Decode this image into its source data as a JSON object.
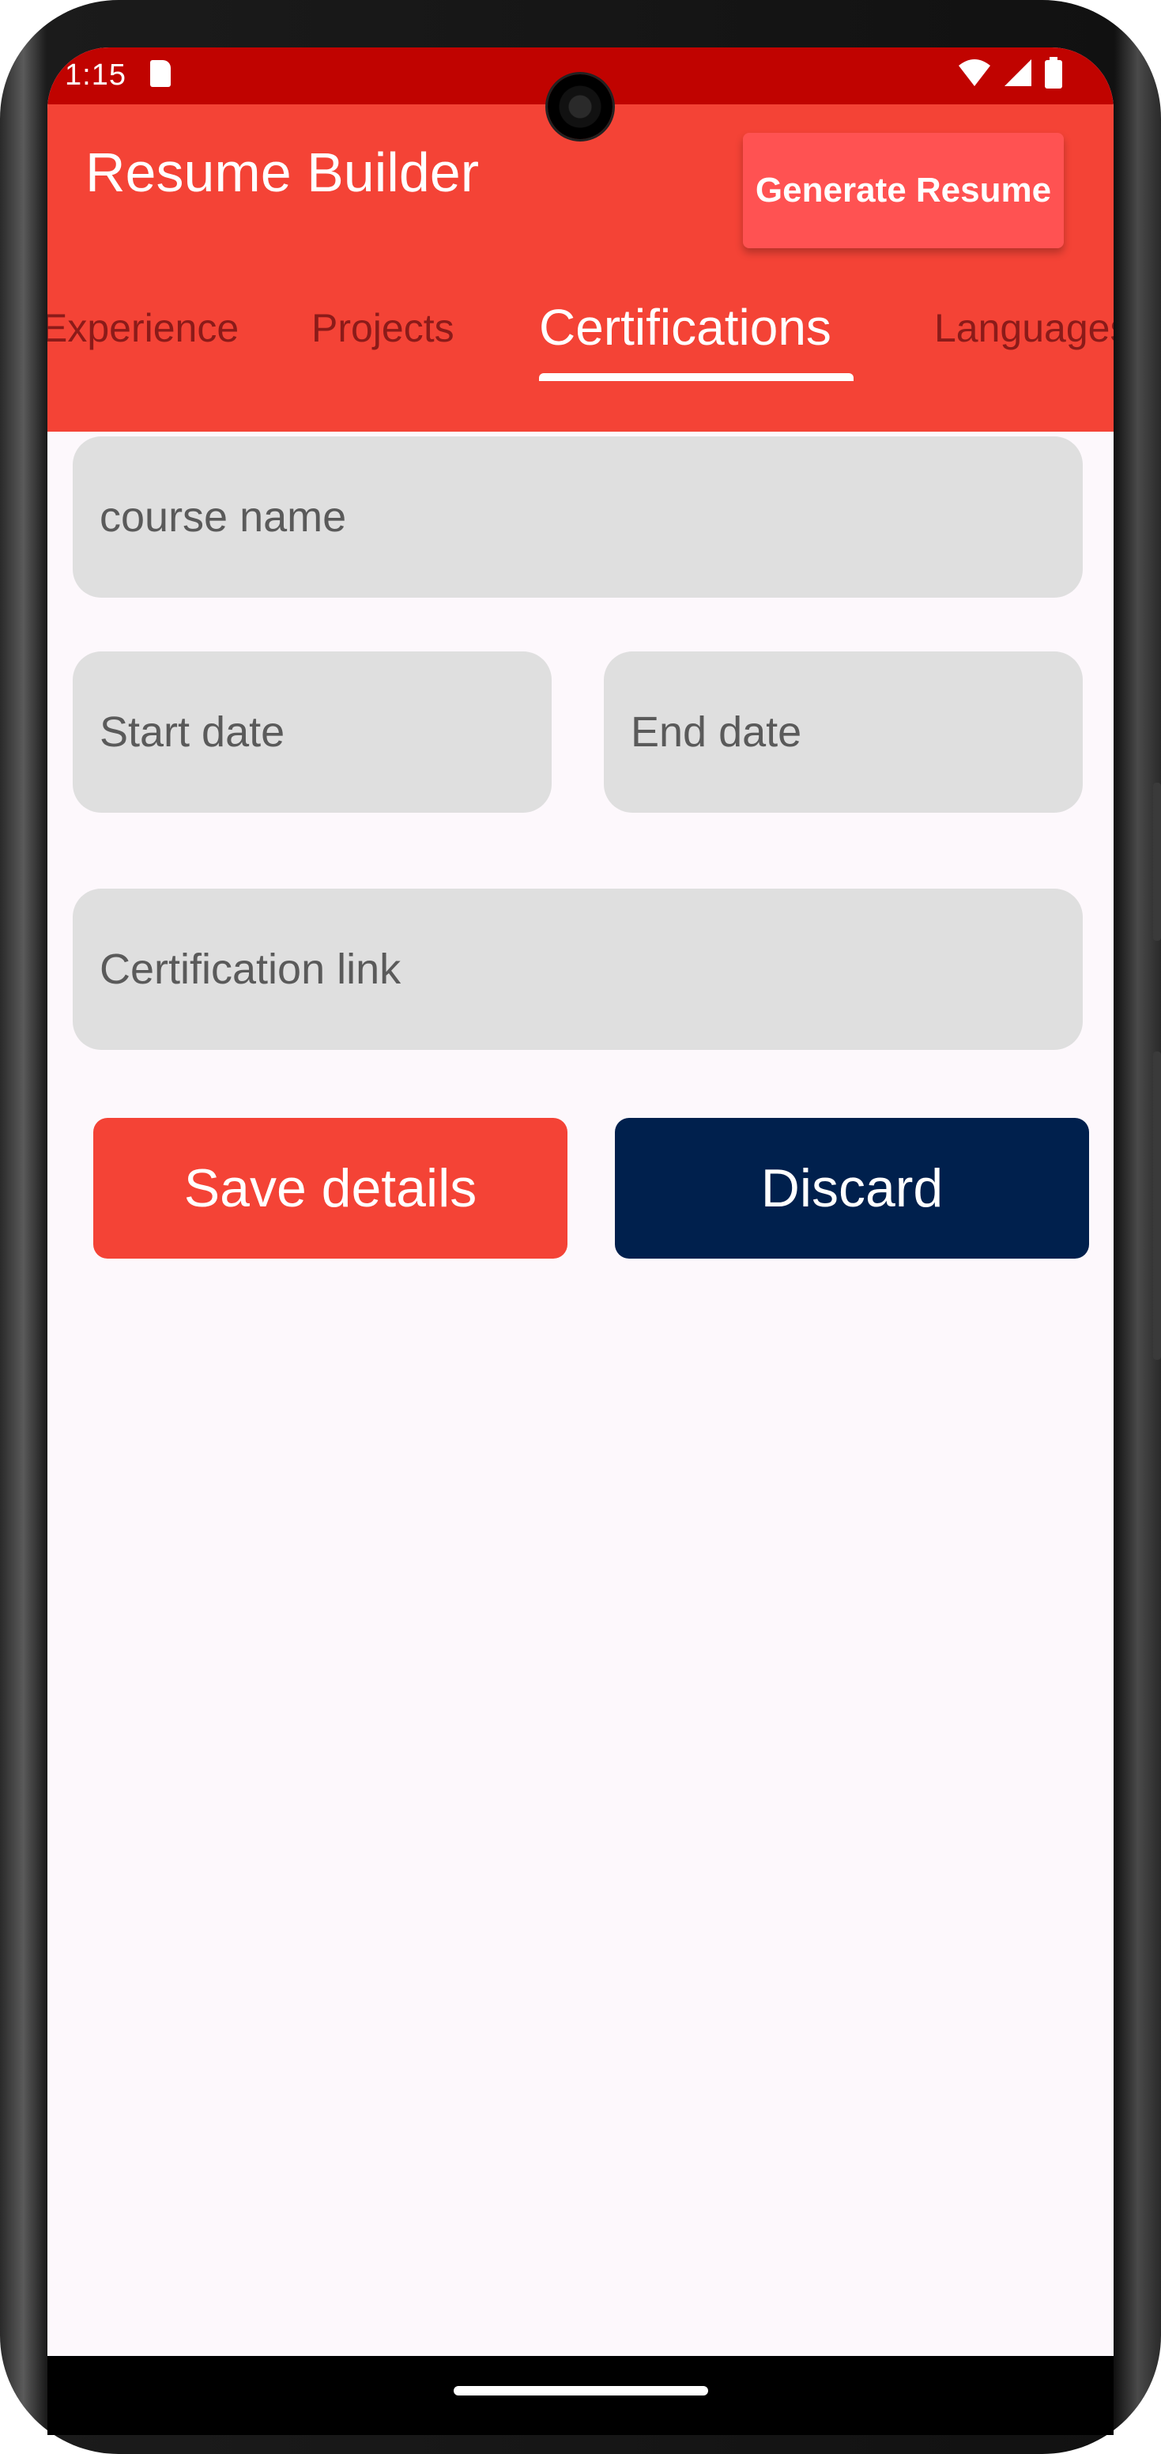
{
  "status_bar": {
    "time": "1:15",
    "icons": [
      "sd-card-icon",
      "wifi-icon",
      "cellular-signal-icon",
      "battery-icon"
    ]
  },
  "app_bar": {
    "title": "Resume Builder",
    "generate_button_label": "Generate Resume"
  },
  "tabs": [
    {
      "label": "Experience",
      "active": false
    },
    {
      "label": "Projects",
      "active": false
    },
    {
      "label": "Certifications",
      "active": true
    },
    {
      "label": "Languages",
      "active": false
    }
  ],
  "form": {
    "course_name": {
      "placeholder": "course name",
      "value": ""
    },
    "start_date": {
      "placeholder": "Start date",
      "value": ""
    },
    "end_date": {
      "placeholder": "End date",
      "value": ""
    },
    "certification_link": {
      "placeholder": "Certification link",
      "value": ""
    }
  },
  "actions": {
    "save_label": "Save details",
    "discard_label": "Discard"
  },
  "colors": {
    "status_bar": "#c00300",
    "app_bar": "#f44336",
    "generate_button": "#ff5252",
    "save_button": "#f44336",
    "discard_button": "#00204d",
    "field_background": "#dfdfdf",
    "screen_background": "#fdf8fc"
  }
}
